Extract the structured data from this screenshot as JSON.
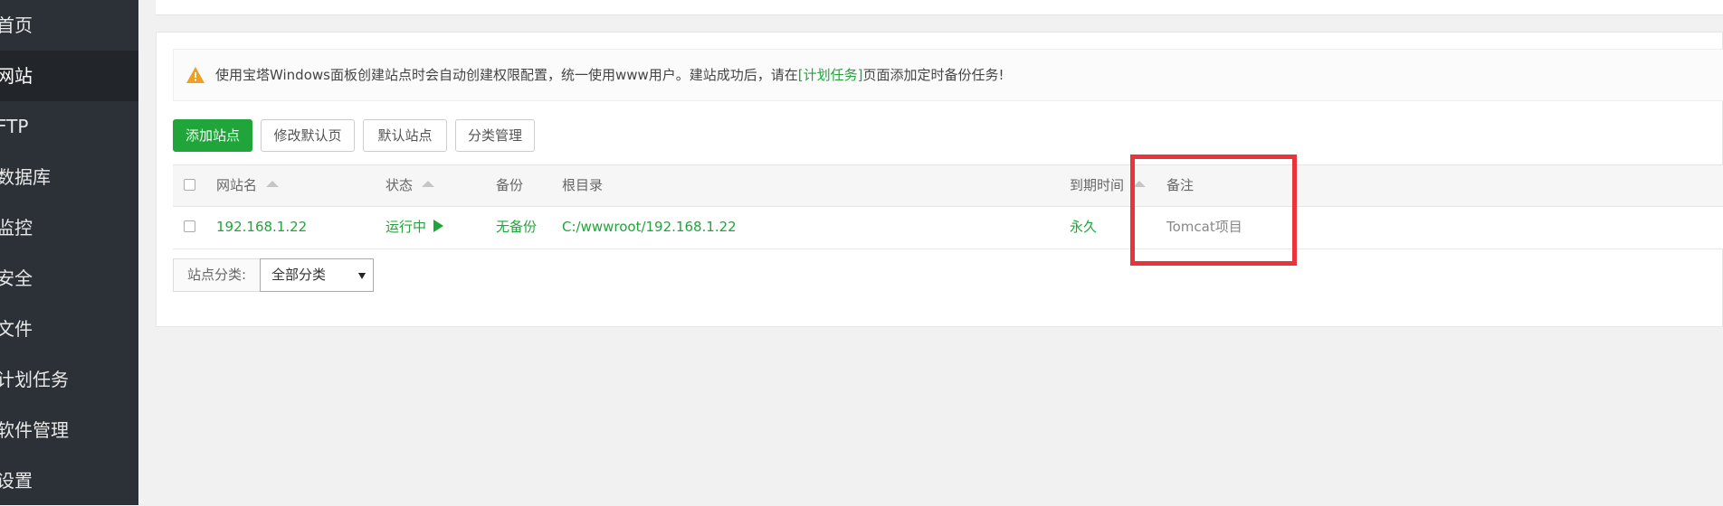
{
  "sidebar": {
    "items": [
      {
        "label": "首页"
      },
      {
        "label": "网站"
      },
      {
        "label": "FTP"
      },
      {
        "label": "数据库"
      },
      {
        "label": "监控"
      },
      {
        "label": "安全"
      },
      {
        "label": "文件"
      },
      {
        "label": "计划任务"
      },
      {
        "label": "软件管理"
      },
      {
        "label": "设置"
      }
    ]
  },
  "notice": {
    "text_before": "使用宝塔Windows面板创建站点时会自动创建权限配置，统一使用www用户。建站成功后，请在",
    "link": "[计划任务]",
    "text_after": "页面添加定时备份任务!"
  },
  "toolbar": {
    "add_site": "添加站点",
    "edit_default_page": "修改默认页",
    "default_site": "默认站点",
    "category_manage": "分类管理"
  },
  "table": {
    "headers": {
      "site_name": "网站名",
      "status": "状态",
      "backup": "备份",
      "root_dir": "根目录",
      "expire": "到期时间",
      "remark": "备注"
    },
    "rows": [
      {
        "site_name": "192.168.1.22",
        "status": "运行中",
        "backup": "无备份",
        "root_dir": "C:/wwwroot/192.168.1.22",
        "expire": "永久",
        "remark": "Tomcat项目"
      }
    ]
  },
  "category": {
    "label": "站点分类:",
    "selected": "全部分类"
  },
  "colors": {
    "accent": "#20a53a",
    "sidebar_bg": "#2c3138",
    "highlight": "#e8343a"
  }
}
